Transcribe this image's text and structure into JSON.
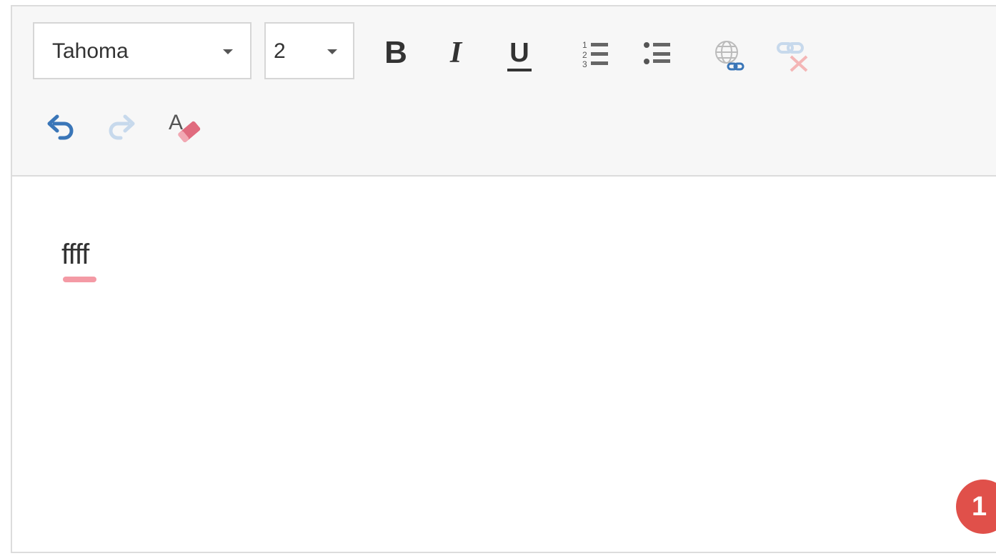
{
  "toolbar": {
    "font_family": {
      "selected": "Tahoma"
    },
    "font_size": {
      "selected": "2"
    },
    "buttons": [
      {
        "name": "bold",
        "icon": "bold-icon"
      },
      {
        "name": "italic",
        "icon": "italic-icon"
      },
      {
        "name": "underline",
        "icon": "underline-icon"
      },
      {
        "name": "ordered-list",
        "icon": "ordered-list-icon"
      },
      {
        "name": "unordered-list",
        "icon": "unordered-list-icon"
      },
      {
        "name": "insert-link",
        "icon": "globe-link-icon"
      },
      {
        "name": "remove-link",
        "icon": "unlink-icon"
      },
      {
        "name": "undo",
        "icon": "undo-icon"
      },
      {
        "name": "redo",
        "icon": "redo-icon"
      },
      {
        "name": "clear-formatting",
        "icon": "eraser-icon"
      }
    ],
    "bold_label": "B",
    "italic_label": "I",
    "underline_label": "U"
  },
  "editor": {
    "text": "ffff"
  },
  "badge": {
    "count": "1"
  },
  "colors": {
    "accent_blue": "#3a76b8",
    "disabled_blue": "#c7d9ec",
    "eraser_red": "#e06b7e",
    "badge_red": "#e0504a",
    "spellcheck_pink": "#f49aa5"
  }
}
